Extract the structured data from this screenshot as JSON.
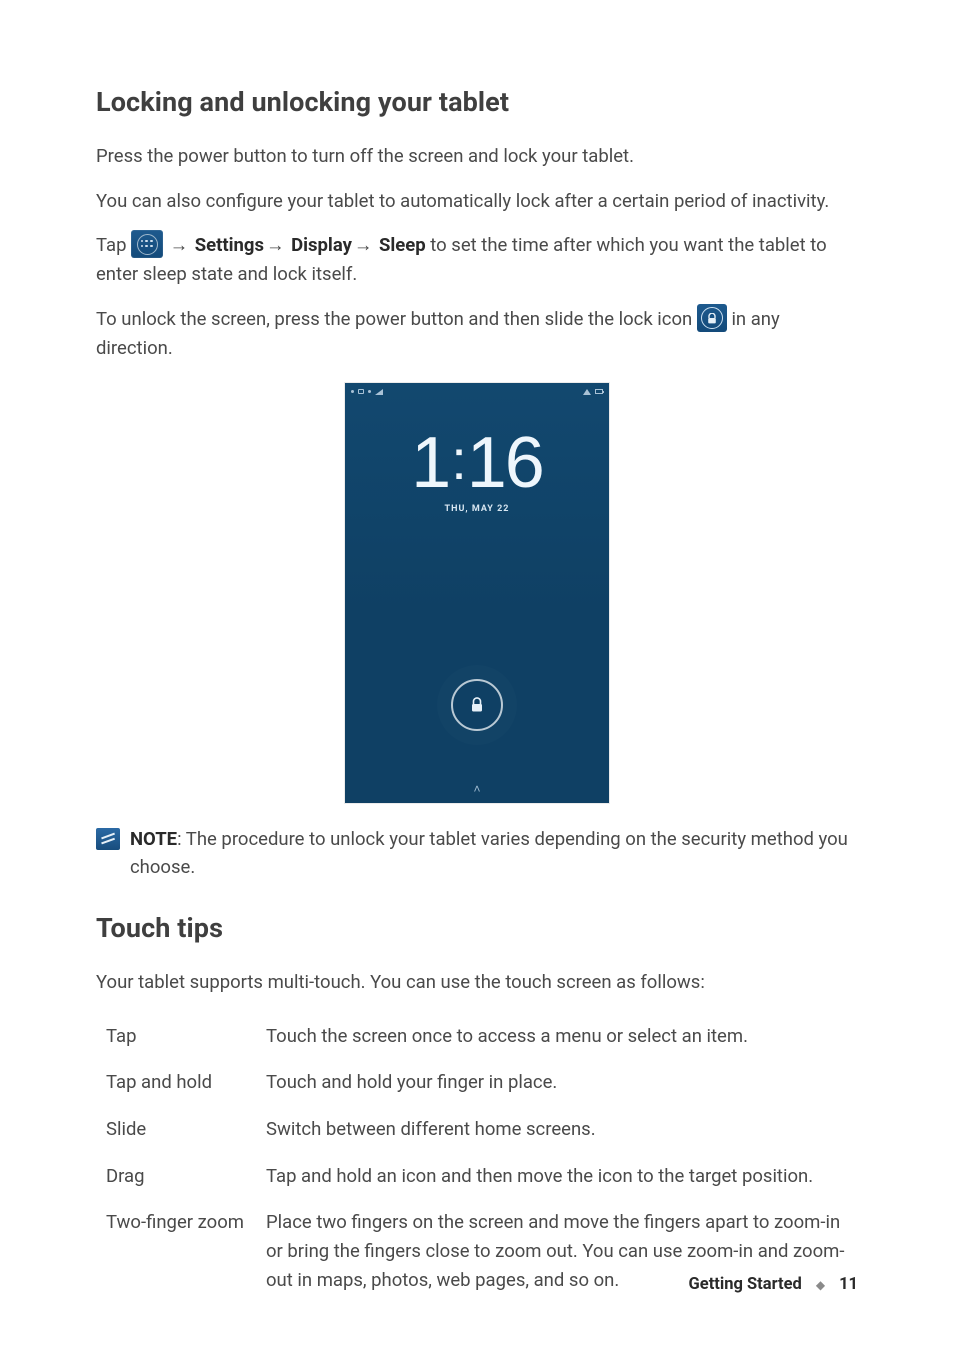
{
  "heading1": "Locking and unlocking your tablet",
  "p1": "Press the power button to turn off the screen and lock your tablet.",
  "p2": "You can also configure your tablet to automatically lock after a certain period of inactivity.",
  "p3_pre": "Tap ",
  "p3_settings": "Settings",
  "p3_display": "Display",
  "p3_sleep": "Sleep",
  "p3_post": " to set the time after which you want the tablet to enter sleep state and lock itself.",
  "p4_pre": "To unlock the screen, press the power button and then slide the lock icon ",
  "p4_post": " in any direction.",
  "arrow": "→",
  "lockscreen": {
    "time_h": "1",
    "time_m": "16",
    "date": "THU, MAY 22",
    "caret": "˄"
  },
  "note_label": "NOTE",
  "note_text": ": The procedure to unlock your tablet varies depending on the security method you  choose.",
  "heading2": "Touch tips",
  "touch_intro": "Your tablet supports multi-touch. You can use the touch screen as follows:",
  "touch": [
    {
      "term": "Tap",
      "desc": "Touch the screen once to access a menu or select an item."
    },
    {
      "term": "Tap and hold",
      "desc": "Touch and hold your finger in place."
    },
    {
      "term": "Slide",
      "desc": "Switch between different home screens."
    },
    {
      "term": "Drag",
      "desc": "Tap and hold an icon and then move the icon to the target position."
    },
    {
      "term": "Two-finger zoom",
      "desc": "Place two fingers on the screen and move the fingers apart to zoom-in or bring the fingers close to zoom out. You can use zoom-in and zoom-out in maps, photos, web pages, and so on."
    }
  ],
  "footer_chapter": "Getting Started",
  "footer_page": "11",
  "footer_diamond": "◆"
}
